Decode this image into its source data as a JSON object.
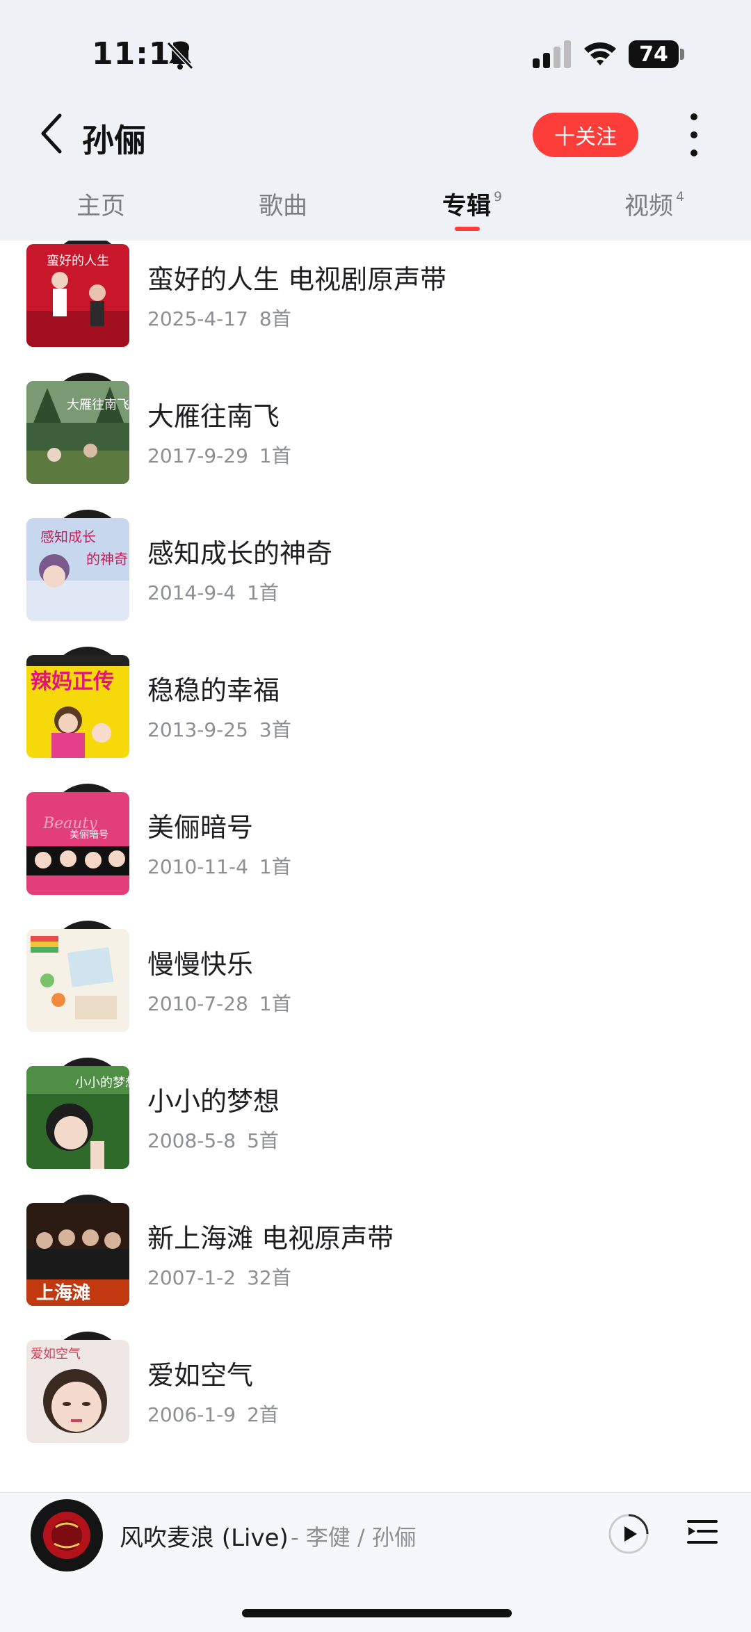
{
  "status_bar": {
    "time": "11:12",
    "battery": "74"
  },
  "header": {
    "artist_name": "孙俪",
    "follow_label": "十关注"
  },
  "tabs": [
    {
      "label": "主页",
      "count": ""
    },
    {
      "label": "歌曲",
      "count": ""
    },
    {
      "label": "专辑",
      "count": "9",
      "active": true
    },
    {
      "label": "视频",
      "count": "4"
    }
  ],
  "albums": [
    {
      "title": "蛮好的人生 电视剧原声带",
      "date": "2025-4-17",
      "count": "8首",
      "cover_text": "蛮好的人生"
    },
    {
      "title": "大雁往南飞",
      "date": "2017-9-29",
      "count": "1首",
      "cover_text": "大雁往南飞"
    },
    {
      "title": "感知成长的神奇",
      "date": "2014-9-4",
      "count": "1首",
      "cover_text": "感知成长的神奇"
    },
    {
      "title": "稳稳的幸福",
      "date": "2013-9-25",
      "count": "3首",
      "cover_text": "辣妈正传"
    },
    {
      "title": "美俪暗号",
      "date": "2010-11-4",
      "count": "1首",
      "cover_text": "美俪暗号"
    },
    {
      "title": "慢慢快乐",
      "date": "2010-7-28",
      "count": "1首",
      "cover_text": ""
    },
    {
      "title": "小小的梦想",
      "date": "2008-5-8",
      "count": "5首",
      "cover_text": "小小的梦想"
    },
    {
      "title": "新上海滩 电视原声带",
      "date": "2007-1-2",
      "count": "32首",
      "cover_text": "上海滩"
    },
    {
      "title": "爱如空气",
      "date": "2006-1-9",
      "count": "2首",
      "cover_text": "爱如空气"
    }
  ],
  "player": {
    "song_title": "风吹麦浪 (Live)",
    "artists": "- 李健 / 孙俪"
  },
  "colors": {
    "accent": "#fc3d39",
    "header_bg": "#eef1f5",
    "meta_text": "#8d8f95"
  },
  "icons": {
    "back": "chevron-left-icon",
    "more": "vertical-ellipsis-icon",
    "play": "play-circle-icon",
    "playlist": "playlist-icon",
    "bell": "bell-slash-icon",
    "signal": "cellular-signal-icon",
    "wifi": "wifi-icon"
  }
}
